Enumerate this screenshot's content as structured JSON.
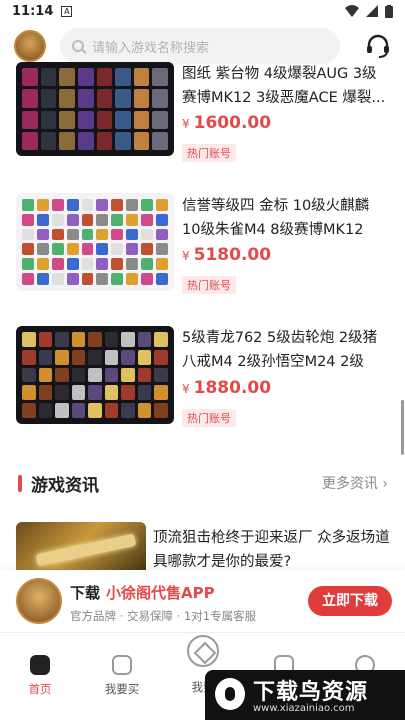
{
  "status": {
    "time": "11:14",
    "notif": "A"
  },
  "search": {
    "placeholder": "请输入游戏名称搜索"
  },
  "listings": [
    {
      "title": "图纸 紫台物 4级爆裂AUG 3级赛博MK12 3级恶魔ACE 爆裂...",
      "price": "1600.00",
      "tag": "热门账号"
    },
    {
      "title": "信誉等级四 金标 10级火麒麟 10级朱雀M4 8级赛博MK12 4...",
      "price": "5180.00",
      "tag": "热门账号"
    },
    {
      "title": "5级青龙762 5级齿轮炮 2级猪八戒M4 2级孙悟空M24 2级唐...",
      "price": "1880.00",
      "tag": "热门账号"
    }
  ],
  "currency": "¥",
  "section": {
    "title": "游戏资讯",
    "more": "更多资讯"
  },
  "news": {
    "title": "顶流狙击枪终于迎来返厂 众多返场道具哪款才是你的最爱?"
  },
  "banner": {
    "prefix": "下载",
    "brand": "小徐阁代售APP",
    "subtitle": "官方品牌 · 交易保障 · 1对1专属客服",
    "button": "立即下载"
  },
  "tabs": [
    {
      "label": "首页",
      "active": true
    },
    {
      "label": "我要买",
      "active": false
    },
    {
      "label": "我要",
      "active": false
    }
  ],
  "watermark": {
    "text": "下载鸟资源",
    "url": "www.xiazainiao.com"
  }
}
